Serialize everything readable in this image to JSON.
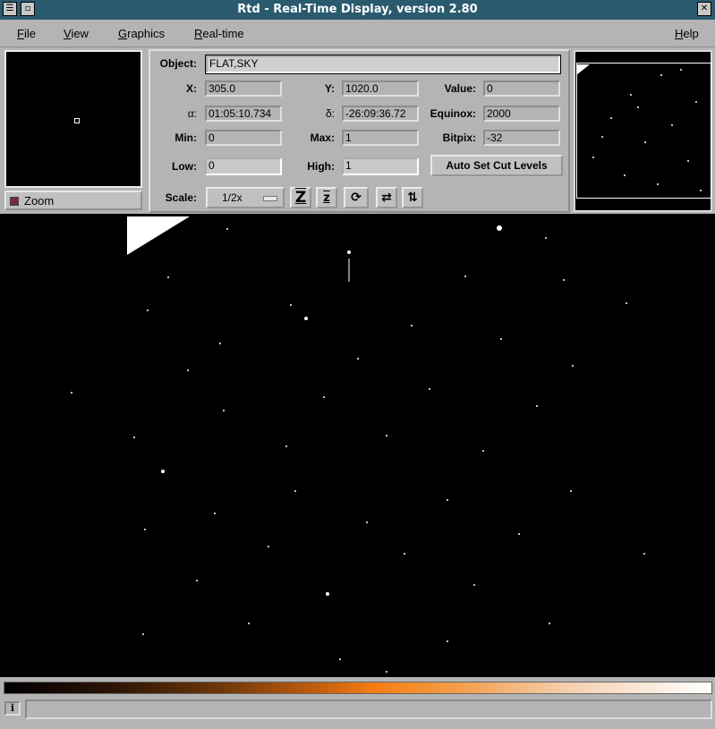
{
  "window": {
    "title": "Rtd - Real-Time Display, version 2.80"
  },
  "menubar": {
    "file": {
      "label": "File"
    },
    "view": {
      "label": "View"
    },
    "graphics": {
      "label": "Graphics"
    },
    "realtime": {
      "label": "Real-time"
    },
    "help": {
      "label": "Help"
    }
  },
  "zoom": {
    "label": "Zoom",
    "checked": true
  },
  "info": {
    "object": {
      "label": "Object:",
      "value": "FLAT,SKY"
    },
    "x": {
      "label": "X:",
      "value": "305.0"
    },
    "y": {
      "label": "Y:",
      "value": "1020.0"
    },
    "value": {
      "label": "Value:",
      "value": "0"
    },
    "alpha": {
      "label": "α:",
      "value": "01:05:10.734"
    },
    "delta": {
      "label": "δ:",
      "value": "-26:09:36.72"
    },
    "equinox": {
      "label": "Equinox:",
      "value": "2000"
    },
    "min": {
      "label": "Min:",
      "value": "0"
    },
    "max": {
      "label": "Max:",
      "value": "1"
    },
    "bitpix": {
      "label": "Bitpix:",
      "value": "-32"
    },
    "low": {
      "label": "Low:",
      "value": "0"
    },
    "high": {
      "label": "High:",
      "value": "1"
    },
    "autocut": {
      "label": "Auto Set Cut Levels"
    },
    "scale": {
      "label": "Scale:",
      "value": "1/2x"
    }
  },
  "icons": {
    "zoom_in": "Z",
    "zoom_out": "z",
    "rotate": "rotate-icon",
    "flip_x": "flip-x-icon",
    "flip_y": "flip-y-icon"
  },
  "colors": {
    "titlebar": "#2a5a6e",
    "background": "#b4b4b4",
    "zoom_check": "#7a2a3a"
  },
  "status": {
    "icon": "i"
  }
}
